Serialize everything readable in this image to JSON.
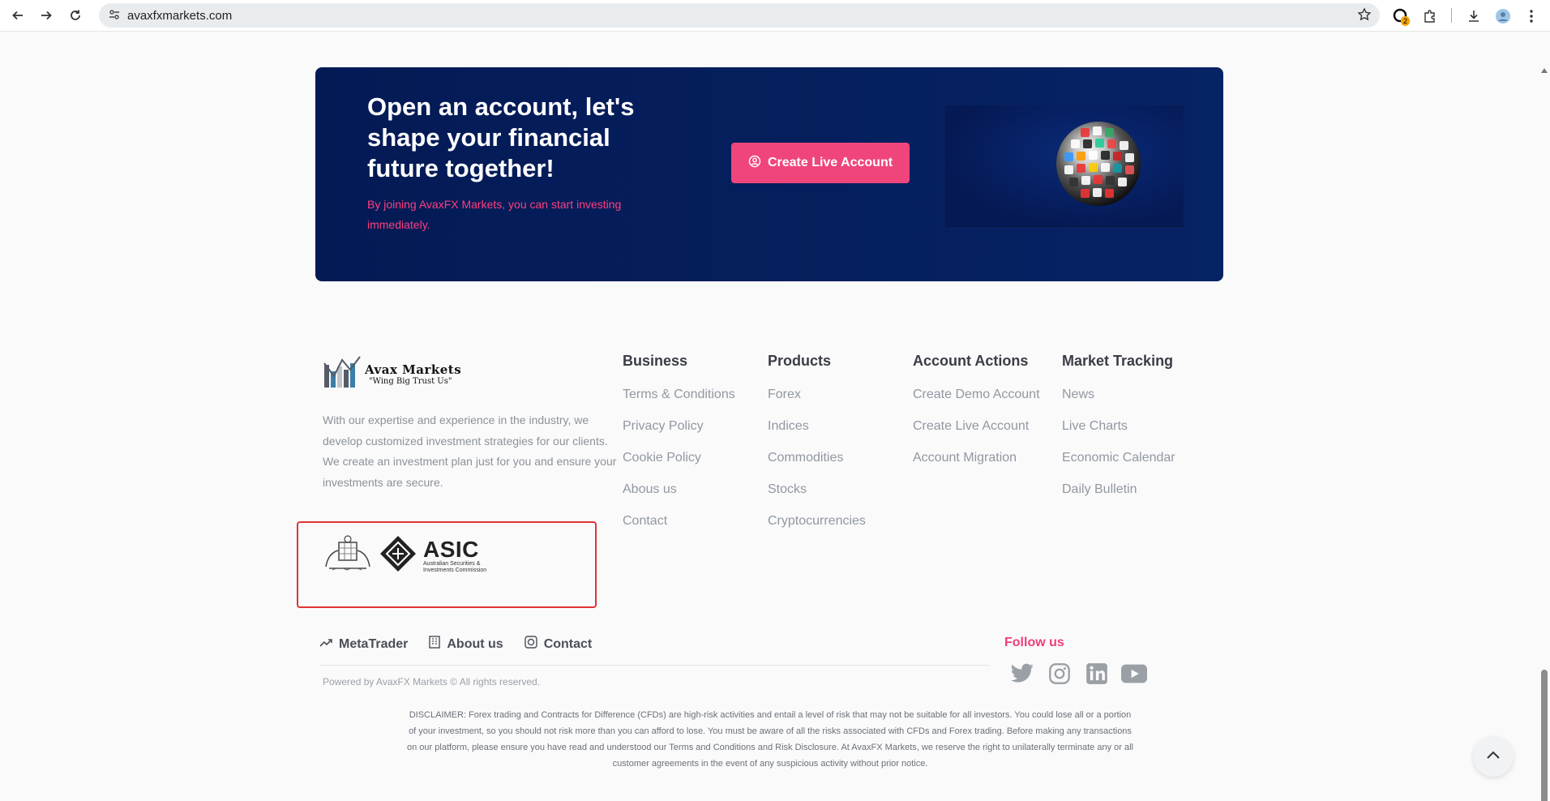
{
  "browser": {
    "url": "avaxfxmarkets.com",
    "extension_badge": "2"
  },
  "banner": {
    "title": "Open an account, let's shape your financial future together!",
    "subtitle": "By joining AvaxFX Markets, you can start investing immediately.",
    "cta_label": "Create Live Account"
  },
  "logo": {
    "name": "Avax Markets",
    "tagline": "\"Wing Big Trust Us\""
  },
  "about": "With our expertise and experience in the industry, we develop customized investment strategies for our clients. We create an investment plan just for you and ensure your investments are secure.",
  "asic": {
    "title": "ASIC",
    "line1": "Australian Securities &",
    "line2": "Investments Commission"
  },
  "columns": [
    {
      "heading": "Business",
      "links": [
        "Terms & Conditions",
        "Privacy Policy",
        "Cookie Policy",
        "Abous us",
        "Contact"
      ]
    },
    {
      "heading": "Products",
      "links": [
        "Forex",
        "Indices",
        "Commodities",
        "Stocks",
        "Cryptocurrencies"
      ]
    },
    {
      "heading": "Account Actions",
      "links": [
        "Create Demo Account",
        "Create Live Account",
        "Account Migration"
      ]
    },
    {
      "heading": "Market Tracking",
      "links": [
        "News",
        "Live Charts",
        "Economic Calendar",
        "Daily Bulletin"
      ]
    }
  ],
  "bottom_links": {
    "metatrader": "MetaTrader",
    "about": "About us",
    "contact": "Contact"
  },
  "copyright": "Powered by AvaxFX Markets © All rights reserved.",
  "follow_label": "Follow us",
  "social_icons": [
    "twitter-icon",
    "instagram-icon",
    "linkedin-icon",
    "youtube-icon"
  ],
  "disclaimer": "DISCLAIMER: Forex trading and Contracts for Difference (CFDs) are high-risk activities and entail a level of risk that may not be suitable for all investors. You could lose all or a portion of your investment, so you should not risk more than you can afford to lose. You must be aware of all the risks associated with CFDs and Forex trading. Before making any transactions on our platform, please ensure you have read and understood our Terms and Conditions and Risk Disclosure. At AvaxFX Markets, we reserve the right to unilaterally terminate any or all customer agreements in the event of any suspicious activity without prior notice.",
  "colors": {
    "banner_bg": "#041a55",
    "accent_pink": "#f0457b",
    "link_gray": "#9198a0"
  }
}
